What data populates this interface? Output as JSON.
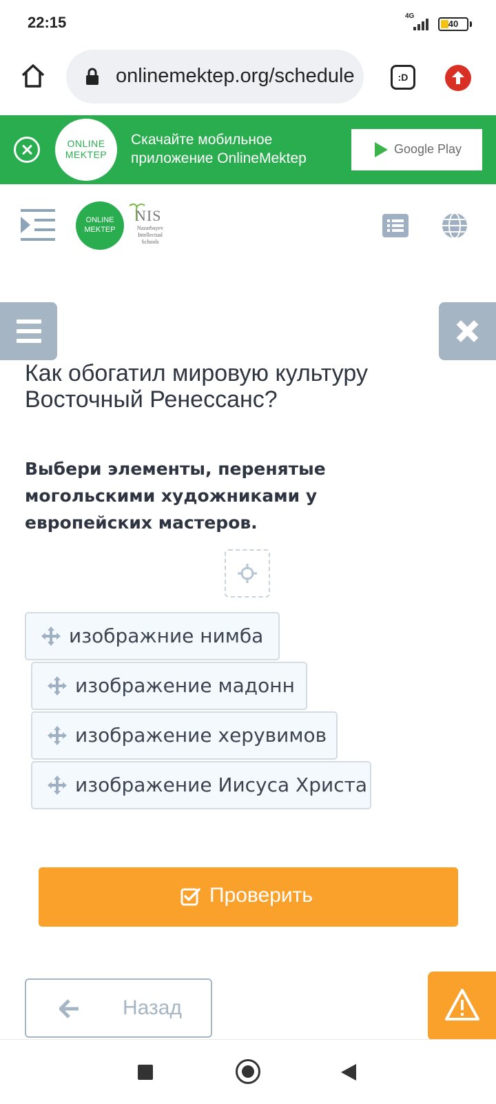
{
  "status_bar": {
    "time": "22:15",
    "network": "4G",
    "battery": "40"
  },
  "browser": {
    "url": "onlinemektep.org/schedule",
    "tabs_label": ":D",
    "icons": [
      "home-icon",
      "lock-icon",
      "tabs-icon",
      "update-icon"
    ]
  },
  "app_banner": {
    "logo_text": "ONLINE MEKTEP",
    "message": "Скачайте мобильное приложение OnlineMektep",
    "store_label": "Google Play",
    "accent_color": "#2aad4f"
  },
  "header": {
    "logo_text": "ONLINE MEKTEP",
    "partner_title": "NIS",
    "partner_subtitle": "Nazarbayev Intellectual Schools",
    "icons": [
      "menu-toggle-icon",
      "list-icon",
      "globe-icon"
    ]
  },
  "question": {
    "title": "Как обогатил мировую культуру Восточный Ренессанс?",
    "task": "Выбери элементы, перенятые могольскими художниками у европейских мастеров.",
    "items": [
      {
        "label": "изображние нимба"
      },
      {
        "label": "изображение мадонн"
      },
      {
        "label": "изображение херувимов"
      },
      {
        "label": "изображение Иисуса Христа"
      }
    ]
  },
  "actions": {
    "check_label": "Проверить",
    "back_label": "Назад",
    "primary_color": "#f9a12b"
  }
}
